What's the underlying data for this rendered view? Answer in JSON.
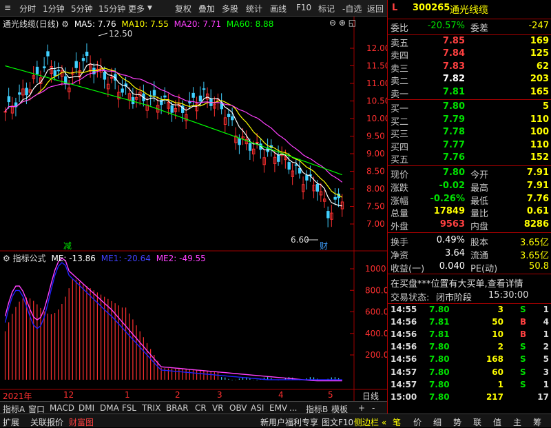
{
  "toolbar": {
    "menu_glyph": "≡",
    "left_items": [
      "分时",
      "1分钟",
      "5分钟",
      "15分钟",
      "更多"
    ],
    "right_items": [
      "复权",
      "叠加",
      "多股",
      "统计",
      "画线",
      "F10",
      "标记",
      "-自选",
      "返回"
    ]
  },
  "chart": {
    "stock_name": "通光线缆",
    "period": "(日线)",
    "ma_legend": [
      {
        "label": "MA5: 7.76",
        "color": "#ffffff"
      },
      {
        "label": "MA10: 7.55",
        "color": "#ffff00"
      },
      {
        "label": "MA20: 7.71",
        "color": "#ff40ff"
      },
      {
        "label": "MA60: 8.88",
        "color": "#00ff00"
      }
    ],
    "high_label": "12.50",
    "low_label": "6.60",
    "marker_jian": "减",
    "marker_cai": "财",
    "price_axis": [
      "12.00",
      "11.50",
      "11.00",
      "10.50",
      "10.00",
      "9.50",
      "9.00",
      "8.50",
      "8.00",
      "7.50",
      "7.00"
    ],
    "ind_title": "指标公式",
    "ind_legend": [
      {
        "label": "ME: -13.86",
        "color": "#ffffff"
      },
      {
        "label": "ME1: -20.64",
        "color": "#4040ff"
      },
      {
        "label": "ME2: -49.55",
        "color": "#ff40ff"
      }
    ],
    "ind_axis": [
      "1000",
      "800.0",
      "600.0",
      "400.0",
      "200.0"
    ],
    "date_axis": [
      "2021年",
      "12",
      "1",
      "2",
      "3",
      "4",
      "5"
    ],
    "period_button": "日线"
  },
  "tabs": {
    "items": [
      "指标A",
      "窗口",
      "MACD",
      "DMI",
      "DMA",
      "FSL",
      "TRIX",
      "BRAR",
      "CR",
      "VR",
      "OBV",
      "ASI",
      "EMV",
      "...",
      "指标B",
      "模板"
    ],
    "scroll": [
      "+",
      "-"
    ]
  },
  "status": {
    "left": [
      "扩展",
      "关联报价",
      "财富图"
    ],
    "middle": [
      "新用户福利专享",
      "图文F10",
      "侧边栏 «"
    ],
    "right": [
      "笔",
      "价",
      "细",
      "势",
      "联",
      "值",
      "主",
      "筹"
    ]
  },
  "quote": {
    "flag": "L",
    "code": "300265",
    "name": "通光线缆",
    "webi_label": "委比",
    "webi_value": "-20.57%",
    "weicha_label": "委差",
    "weicha_value": "-247",
    "asks": [
      {
        "label": "卖五",
        "price": "7.85",
        "vol": "169"
      },
      {
        "label": "卖四",
        "price": "7.84",
        "vol": "125"
      },
      {
        "label": "卖三",
        "price": "7.83",
        "vol": "62"
      },
      {
        "label": "卖二",
        "price": "7.82",
        "vol": "203"
      },
      {
        "label": "卖一",
        "price": "7.81",
        "vol": "165"
      }
    ],
    "bids": [
      {
        "label": "买一",
        "price": "7.80",
        "vol": "5"
      },
      {
        "label": "买二",
        "price": "7.79",
        "vol": "110"
      },
      {
        "label": "买三",
        "price": "7.78",
        "vol": "100"
      },
      {
        "label": "买四",
        "price": "7.77",
        "vol": "110"
      },
      {
        "label": "买五",
        "price": "7.76",
        "vol": "152"
      }
    ],
    "stats": [
      {
        "l1": "现价",
        "v1": "7.80",
        "c1": "grn",
        "l2": "今开",
        "v2": "7.91",
        "c2": "red"
      },
      {
        "l1": "涨跌",
        "v1": "-0.02",
        "c1": "grn",
        "l2": "最高",
        "v2": "7.91",
        "c2": "red"
      },
      {
        "l1": "涨幅",
        "v1": "-0.26%",
        "c1": "grn",
        "l2": "最低",
        "v2": "7.76",
        "c2": "grn"
      },
      {
        "l1": "总量",
        "v1": "17849",
        "c1": "yel",
        "l2": "量比",
        "v2": "0.61",
        "c2": "yel"
      },
      {
        "l1": "外盘",
        "v1": "9563",
        "c1": "red",
        "l2": "内盘",
        "v2": "8286",
        "c2": "grn"
      }
    ],
    "stats2": [
      {
        "l1": "换手",
        "v1": "0.49%",
        "l2": "股本",
        "v2": "3.65亿"
      },
      {
        "l1": "净资",
        "v1": "3.64",
        "l2": "流通",
        "v2": "3.65亿"
      },
      {
        "l1": "收益(一)",
        "v1": "0.040",
        "l2": "PE(动)",
        "v2": "50.8"
      }
    ],
    "notice": "在买盘***位置有大买单,查看详情",
    "trade_state_label": "交易状态:",
    "trade_state": "闭市阶段",
    "trade_time": "15:30:00"
  },
  "ticks": [
    {
      "time": "14:55",
      "price": "7.80",
      "vol": "3",
      "bs": "S",
      "n": "1"
    },
    {
      "time": "14:56",
      "price": "7.81",
      "vol": "50",
      "bs": "B",
      "n": "4"
    },
    {
      "time": "14:56",
      "price": "7.81",
      "vol": "10",
      "bs": "B",
      "n": "1"
    },
    {
      "time": "14:56",
      "price": "7.80",
      "vol": "2",
      "bs": "S",
      "n": "2"
    },
    {
      "time": "14:56",
      "price": "7.80",
      "vol": "168",
      "bs": "S",
      "n": "5"
    },
    {
      "time": "14:57",
      "price": "7.80",
      "vol": "60",
      "bs": "S",
      "n": "3"
    },
    {
      "time": "14:57",
      "price": "7.80",
      "vol": "1",
      "bs": "S",
      "n": "1"
    },
    {
      "time": "15:00",
      "price": "7.80",
      "vol": "217",
      "bs": "",
      "n": "17"
    }
  ]
}
